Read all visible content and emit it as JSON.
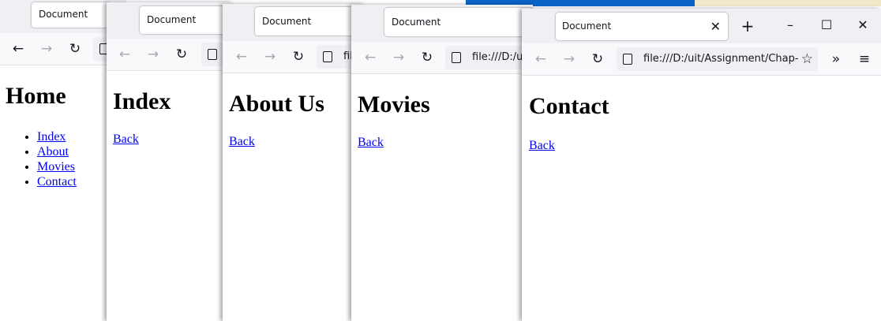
{
  "colors": {
    "link": "#0000ee",
    "tabstrip": "#f0f0f4",
    "desktop_blue": "#0a64c8",
    "desktop_cream": "#efe8c9"
  },
  "windows": [
    {
      "tab_title": "Document",
      "heading": "Home",
      "links": [
        "Index",
        "About",
        "Movies",
        "Contact"
      ]
    },
    {
      "tab_title": "Document",
      "heading": "Index",
      "link": "Back"
    },
    {
      "tab_title": "Document",
      "heading": "About Us",
      "link": "Back",
      "url_fragment": "fil"
    },
    {
      "tab_title": "Document",
      "heading": "Movies",
      "link": "Back",
      "url_fragment": "file:///D:/ui"
    },
    {
      "tab_title": "Document",
      "heading": "Contact",
      "link": "Back",
      "url": "file:///D:/uit/Assignment/Chap-",
      "icons": [
        "back-arrow-icon",
        "forward-arrow-icon",
        "reload-icon",
        "page-icon",
        "bookmark-star-icon",
        "overflow-chevron-icon",
        "hamburger-menu-icon",
        "new-tab-plus-icon",
        "close-tab-icon",
        "minimize-icon",
        "maximize-icon",
        "close-window-icon"
      ]
    }
  ]
}
